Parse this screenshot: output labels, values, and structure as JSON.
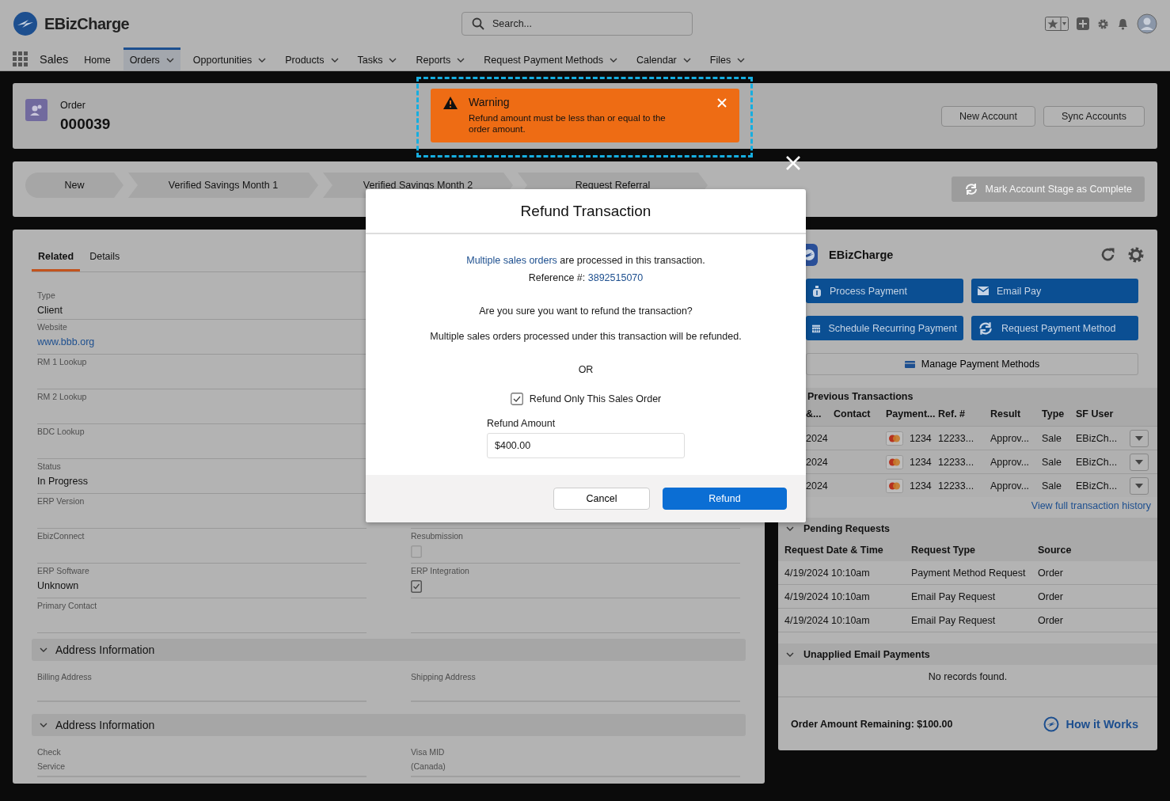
{
  "app": {
    "name": "EBizCharge",
    "search": {
      "placeholder": "Search..."
    }
  },
  "nav": {
    "app_name": "Sales",
    "items": [
      {
        "label": "Home",
        "selected": false,
        "has_menu": false
      },
      {
        "label": "Orders",
        "selected": true,
        "has_menu": true
      },
      {
        "label": "Opportunities",
        "selected": false,
        "has_menu": true
      },
      {
        "label": "Products",
        "selected": false,
        "has_menu": true
      },
      {
        "label": "Tasks",
        "selected": false,
        "has_menu": true
      },
      {
        "label": "Reports",
        "selected": false,
        "has_menu": true
      },
      {
        "label": "Request Payment Methods",
        "selected": false,
        "has_menu": true
      },
      {
        "label": "Calendar",
        "selected": false,
        "has_menu": true
      },
      {
        "label": "Files",
        "selected": false,
        "has_menu": true
      }
    ]
  },
  "record": {
    "type": "Order",
    "number": "000039",
    "actions": [
      "New Account",
      "Sync Accounts"
    ]
  },
  "path": {
    "stages": [
      "New",
      "Verified Savings Month 1",
      "Verified Savings Month 2",
      "Request Referral"
    ],
    "complete_button": {
      "label": "Mark Account Stage as Complete",
      "disabled": true
    }
  },
  "details": {
    "tabs": [
      {
        "label": "Related",
        "selected": true
      },
      {
        "label": "Details",
        "selected": false
      }
    ],
    "left_fields": [
      {
        "label": "Type",
        "kind": "text",
        "value": "Client"
      },
      {
        "label": "Website",
        "kind": "link",
        "value": "www.bbb.org"
      },
      {
        "label": "RM 1 Lookup"
      },
      {
        "label": "RM 2 Lookup"
      },
      {
        "label": "BDC Lookup"
      },
      {
        "label": "Status",
        "kind": "text",
        "value": "In Progress"
      },
      {
        "label": "ERP Version"
      },
      {
        "label": "EbizConnect"
      },
      {
        "label": "ERP Software",
        "kind": "text",
        "value": "Unknown"
      },
      {
        "label": "Primary Contact"
      }
    ],
    "right_fields": [
      {
        "label": "Resubmission",
        "kind": "checkbox",
        "checked": false
      },
      {
        "label": "ERP Integration",
        "kind": "checkbox",
        "checked": true
      }
    ],
    "sections": [
      {
        "title": "Address Information",
        "expanded": true,
        "fields": [
          "Billing Address",
          "Shipping Address"
        ]
      },
      {
        "title": "Address Information",
        "expanded": true,
        "fields": [
          "Check\nService",
          "Visa MID\n(Canada)"
        ]
      }
    ]
  },
  "warning": {
    "title": "Warning",
    "message": "Refund amount must be less than or equal to the order amount."
  },
  "modal": {
    "title": "Refund Transaction",
    "info": {
      "link": "Multiple sales orders",
      "rest": "are processed in this transaction."
    },
    "reference": {
      "label": "Reference #:",
      "link": "3892515070"
    },
    "question": "Are you sure you want to refund the transaction?",
    "note": "Multiple sales orders processed under this transaction will be refunded.",
    "or": "OR",
    "only_this_order": {
      "label": "Refund Only This Sales Order",
      "checked": true
    },
    "amount": {
      "label": "Refund Amount",
      "value": "$400.00"
    },
    "buttons": [
      "Cancel",
      "Refund"
    ]
  },
  "ebiz_panel": {
    "title": "EBizCharge",
    "actions": [
      {
        "label": "Process Payment",
        "kind": "payment"
      },
      {
        "label": "Email Pay",
        "kind": "email"
      },
      {
        "label": "Schedule Recurring Payment",
        "kind": "calendar"
      },
      {
        "label": "Request Payment Method",
        "kind": "sync"
      }
    ],
    "manage_button": "Manage Payment Methods",
    "previous": {
      "title": "Previous Transactions",
      "columns": [
        "&...",
        "Contact",
        "Payment...",
        "Ref. #",
        "Result",
        "Type",
        "SF User"
      ],
      "rows": [
        {
          "date": "2024",
          "last4": "1234",
          "ref": "12233...",
          "result": "Approv...",
          "type": "Sale",
          "user": "EBizCh..."
        },
        {
          "date": "2024",
          "last4": "1234",
          "ref": "12233...",
          "result": "Approv...",
          "type": "Sale",
          "user": "EBizCh..."
        },
        {
          "date": "2024",
          "last4": "1234",
          "ref": "12233...",
          "result": "Approv...",
          "type": "Sale",
          "user": "EBizCh..."
        }
      ],
      "history_link": "View full transaction history"
    },
    "pending": {
      "title": "Pending Requests",
      "expanded": true,
      "columns": [
        "Request Date & Time",
        "Request Type",
        "Source"
      ],
      "rows": [
        [
          "4/19/2024 10:10am",
          "Payment Method Request",
          "Order"
        ],
        [
          "4/19/2024 10:10am",
          "Email Pay Request",
          "Order"
        ],
        [
          "4/19/2024 10:10am",
          "Email Pay Request",
          "Order"
        ]
      ]
    },
    "unapplied": {
      "title": "Unapplied Email Payments",
      "expanded": true,
      "empty": "No records found."
    },
    "remaining": "Order Amount Remaining: $100.00",
    "how_link": "How it Works"
  }
}
